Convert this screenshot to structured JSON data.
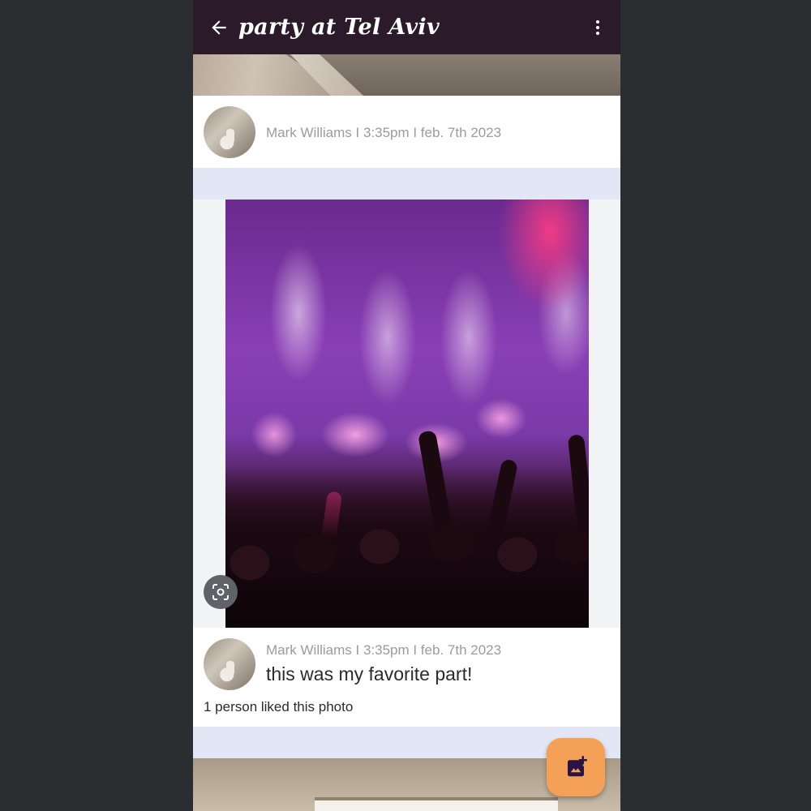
{
  "app_bar": {
    "title": "party at Tel Aviv",
    "back_icon": "arrow-back-icon",
    "menu_icon": "more-vert-icon"
  },
  "posts": [
    {
      "meta": "Mark Williams I 3:35pm I feb. 7th 2023"
    },
    {
      "meta": "Mark Williams I 3:35pm I feb. 7th 2023",
      "caption": "this was my favorite part!",
      "likes": "1 person liked this photo"
    }
  ],
  "lens_icon": "image-search-icon",
  "fab": {
    "icon": "add-photo-icon",
    "color": "#f5a057"
  },
  "colors": {
    "app_bar": "#2a1a2a",
    "separator": "#e3e6f5",
    "meta_text": "#9a9aa6"
  }
}
